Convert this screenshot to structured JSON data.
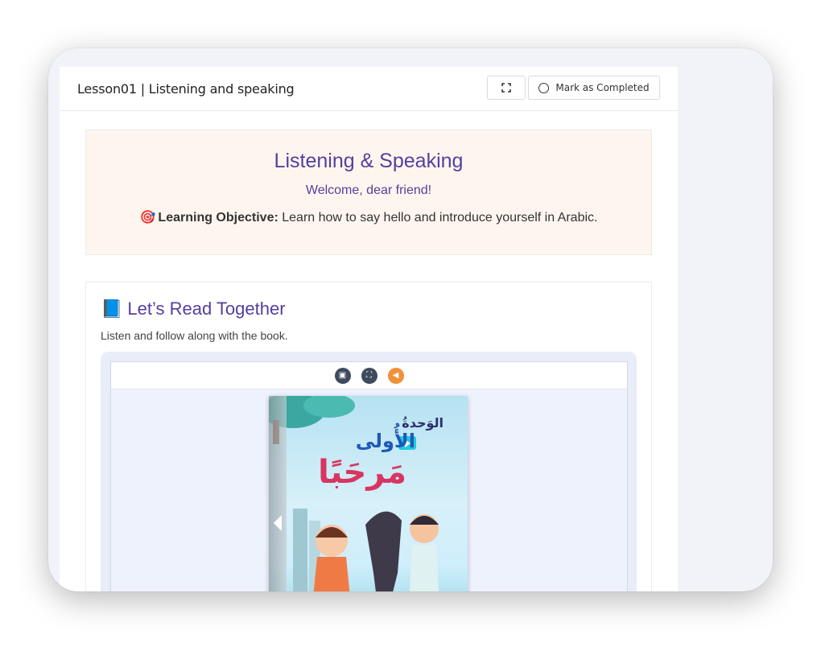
{
  "header": {
    "lesson_title": "Lesson01 | Listening and speaking",
    "fullscreen_icon": "fullscreen-icon",
    "mark_completed_label": "Mark as Completed"
  },
  "hero": {
    "title": "Listening & Speaking",
    "subtitle": "Welcome, dear friend!",
    "objective_icon": "target-icon",
    "objective_label": "Learning Objective:",
    "objective_text": " Learn how to say hello and introduce yourself in Arabic."
  },
  "read_section": {
    "icon": "book-icon",
    "title": "Let’s Read Together",
    "subtitle": "Listen and follow along with the book."
  },
  "viewer": {
    "tools": [
      "pages-icon",
      "fullscreen-icon",
      "audio-icon"
    ],
    "cover": {
      "unit_label": "الوَحدةُ",
      "unit_number": "الأُولى",
      "title": "مَرحَبًا"
    }
  },
  "colors": {
    "accent": "#553ea0",
    "hero_bg": "#fef6ee",
    "audio": "#f0913a"
  }
}
